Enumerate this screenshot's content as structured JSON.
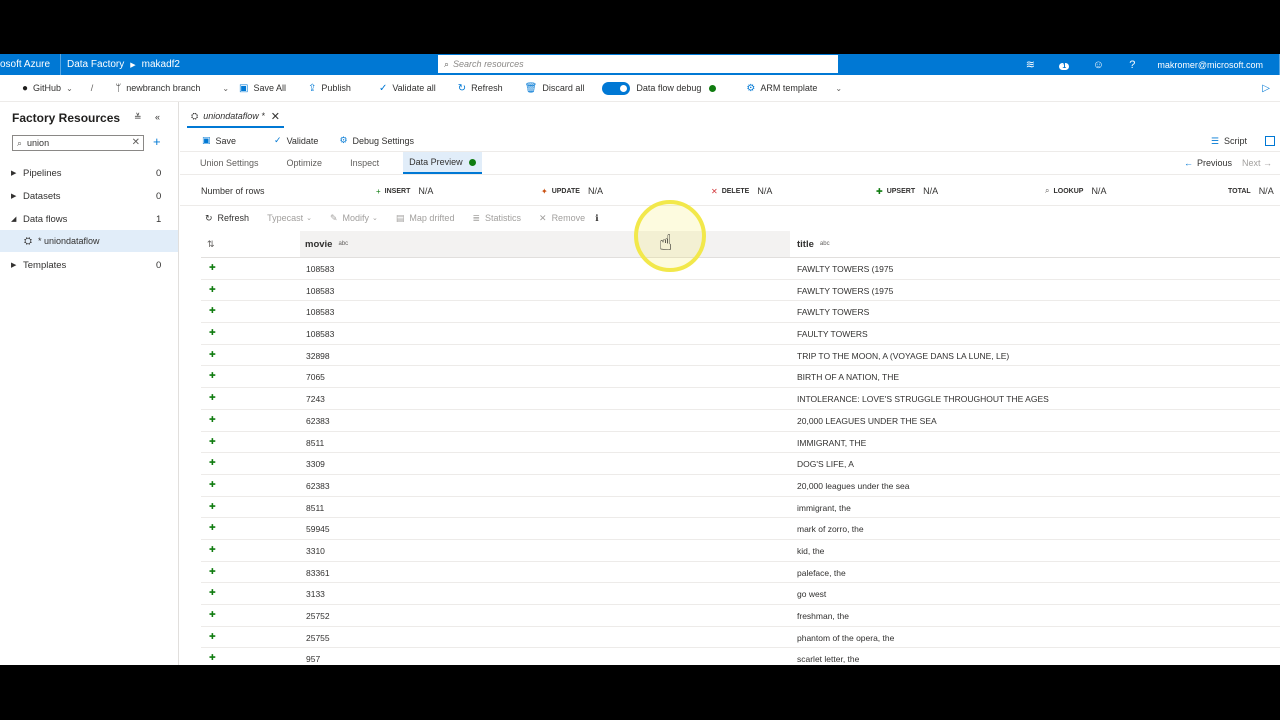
{
  "topbar": {
    "brand": "osoft Azure",
    "crumbs": [
      "Data Factory",
      "makadf2"
    ],
    "search_placeholder": "Search resources",
    "notification_count": "1",
    "user": "makromer@microsoft.com"
  },
  "cmdbar": {
    "github": "GitHub",
    "slash": "/",
    "branch": "newbranch branch",
    "save_all": "Save All",
    "publish": "Publish",
    "validate_all": "Validate all",
    "refresh": "Refresh",
    "discard_all": "Discard all",
    "debug": "Data flow debug",
    "arm": "ARM template"
  },
  "sidebar": {
    "title": "Factory Resources",
    "search_value": "union",
    "items": [
      {
        "label": "Pipelines",
        "count": "0"
      },
      {
        "label": "Datasets",
        "count": "0"
      },
      {
        "label": "Data flows",
        "count": "1"
      },
      {
        "label": "Templates",
        "count": "0"
      }
    ],
    "dataflow_child": "* uniondataflow"
  },
  "doc_tab": "uniondataflow *",
  "subcmd": {
    "save": "Save",
    "validate": "Validate",
    "debug_settings": "Debug Settings",
    "script": "Script"
  },
  "panel_tabs": {
    "union_settings": "Union Settings",
    "optimize": "Optimize",
    "inspect": "Inspect",
    "data_preview": "Data Preview",
    "previous": "Previous",
    "next": "Next"
  },
  "rows_bar": {
    "label": "Number of rows",
    "stats": [
      {
        "key": "INSERT",
        "value": "N/A"
      },
      {
        "key": "UPDATE",
        "value": "N/A"
      },
      {
        "key": "DELETE",
        "value": "N/A"
      },
      {
        "key": "UPSERT",
        "value": "N/A"
      },
      {
        "key": "LOOKUP",
        "value": "N/A"
      },
      {
        "key": "TOTAL",
        "value": "N/A"
      }
    ]
  },
  "grid_toolbar": {
    "refresh": "Refresh",
    "typecast": "Typecast",
    "modify": "Modify",
    "map_drifted": "Map drifted",
    "statistics": "Statistics",
    "remove": "Remove"
  },
  "table": {
    "columns": [
      {
        "name": "movie",
        "type": "abc"
      },
      {
        "name": "title",
        "type": "abc"
      }
    ],
    "rows": [
      {
        "movie": "108583",
        "title": "FAWLTY TOWERS (1975"
      },
      {
        "movie": "108583",
        "title": "FAWLTY TOWERS (1975"
      },
      {
        "movie": "108583",
        "title": "FAWLTY TOWERS"
      },
      {
        "movie": "108583",
        "title": "FAULTY TOWERS"
      },
      {
        "movie": "32898",
        "title": "TRIP TO THE MOON, A (VOYAGE DANS LA LUNE, LE)"
      },
      {
        "movie": "7065",
        "title": "BIRTH OF A NATION, THE"
      },
      {
        "movie": "7243",
        "title": "INTOLERANCE: LOVE'S STRUGGLE THROUGHOUT THE AGES"
      },
      {
        "movie": "62383",
        "title": "20,000 LEAGUES UNDER THE SEA"
      },
      {
        "movie": "8511",
        "title": "IMMIGRANT, THE"
      },
      {
        "movie": "3309",
        "title": "DOG'S LIFE, A"
      },
      {
        "movie": "62383",
        "title": "20,000 leagues under the sea"
      },
      {
        "movie": "8511",
        "title": "immigrant, the"
      },
      {
        "movie": "59945",
        "title": "mark of zorro, the"
      },
      {
        "movie": "3310",
        "title": "kid, the"
      },
      {
        "movie": "83361",
        "title": "paleface, the"
      },
      {
        "movie": "3133",
        "title": "go west"
      },
      {
        "movie": "25752",
        "title": "freshman, the"
      },
      {
        "movie": "25755",
        "title": "phantom of the opera, the"
      },
      {
        "movie": "957",
        "title": "scarlet letter, the"
      }
    ]
  },
  "colors": {
    "azure_blue": "#0078d4",
    "green": "#107c10",
    "delete_red": "#d13438",
    "update_orange": "#ca5010",
    "cursor_highlight": "#f2e84b"
  }
}
